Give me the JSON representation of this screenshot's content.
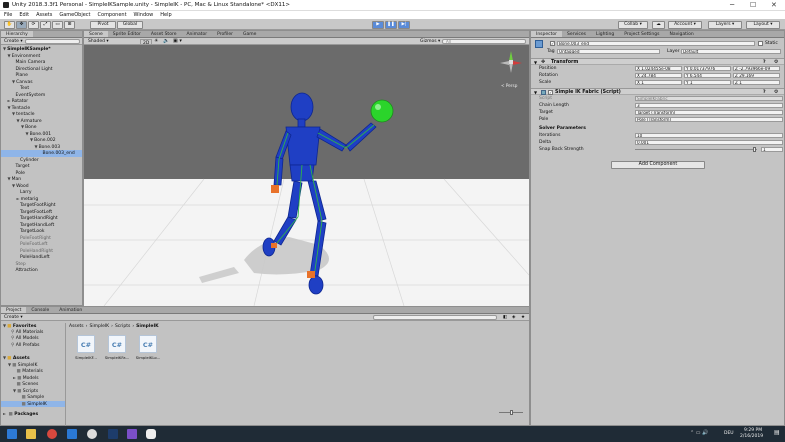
{
  "window": {
    "title": "Unity 2018.3.3f1 Personal - SimpleIKSample.unity - SimpleIK - PC, Mac & Linux Standalone* <DX11>"
  },
  "menu": [
    "File",
    "Edit",
    "Assets",
    "GameObject",
    "Component",
    "Window",
    "Help"
  ],
  "toolbar": {
    "pivot": "Pivot",
    "global": "Global",
    "collab": "Collab",
    "account": "Account",
    "layers": "Layers",
    "layout": "Layout"
  },
  "hierarchy": {
    "tab": "Hierarchy",
    "create": "Create",
    "rows": [
      {
        "t": "SimpleIKSample*",
        "d": 0,
        "a": "▼",
        "b": true
      },
      {
        "t": "Environment",
        "d": 1,
        "a": "▼"
      },
      {
        "t": "Main Camera",
        "d": 2
      },
      {
        "t": "Directional Light",
        "d": 2
      },
      {
        "t": "Plane",
        "d": 2
      },
      {
        "t": "Canvas",
        "d": 2,
        "a": "▼"
      },
      {
        "t": "Text",
        "d": 3
      },
      {
        "t": "EventSystem",
        "d": 2
      },
      {
        "t": "Rotator",
        "d": 1,
        "a": "►"
      },
      {
        "t": "Tentacle",
        "d": 1,
        "a": "▼"
      },
      {
        "t": "tentacle",
        "d": 2,
        "a": "▼"
      },
      {
        "t": "Armature",
        "d": 3,
        "a": "▼"
      },
      {
        "t": "Bone",
        "d": 4,
        "a": "▼"
      },
      {
        "t": "Bone.001",
        "d": 5,
        "a": "▼"
      },
      {
        "t": "Bone.002",
        "d": 6,
        "a": "▼"
      },
      {
        "t": "Bone.003",
        "d": 7,
        "a": "▼"
      },
      {
        "t": "Bone.003_end",
        "d": 8,
        "sel": true
      },
      {
        "t": "Cylinder",
        "d": 3
      },
      {
        "t": "Target",
        "d": 2
      },
      {
        "t": "Pole",
        "d": 2
      },
      {
        "t": "Man",
        "d": 1,
        "a": "▼"
      },
      {
        "t": "Wood",
        "d": 2,
        "a": "▼"
      },
      {
        "t": "Larry",
        "d": 3
      },
      {
        "t": "metarig",
        "d": 3,
        "a": "►"
      },
      {
        "t": "TargetFootRight",
        "d": 3
      },
      {
        "t": "TargetFootLeft",
        "d": 3
      },
      {
        "t": "TargetHandRight",
        "d": 3
      },
      {
        "t": "TargetHandLeft",
        "d": 3
      },
      {
        "t": "TargetLook",
        "d": 3
      },
      {
        "t": "PoleFootRight",
        "d": 3,
        "g": true
      },
      {
        "t": "PoleFootLeft",
        "d": 3,
        "g": true
      },
      {
        "t": "PoleHandRight",
        "d": 3,
        "g": true
      },
      {
        "t": "PoleHandLeft",
        "d": 3
      },
      {
        "t": "Step",
        "d": 2,
        "g": true
      },
      {
        "t": "Attraction",
        "d": 2
      }
    ]
  },
  "scene": {
    "tabs": [
      "Scene",
      "Sprite Editor",
      "Asset Store",
      "Animator",
      "Profiler",
      "Game"
    ],
    "shaded": "Shaded",
    "mode2d": "2D",
    "gizmos": "Gizmos",
    "search_ph": "All",
    "persp": "< Persp"
  },
  "inspector": {
    "tabs": [
      "Inspector",
      "Services",
      "Lighting",
      "Project Settings",
      "Navigation"
    ],
    "object_name": "Bone.003_end",
    "static": "Static",
    "tag_label": "Tag",
    "tag": "Untagged",
    "layer_label": "Layer",
    "layer": "Default",
    "transform": {
      "title": "Transform",
      "position_label": "Position",
      "rotation_label": "Rotation",
      "scale_label": "Scale",
      "position": [
        "X 1.024455e-08",
        "Y 0.01737976",
        "Z -2.793966e-09"
      ],
      "rotation": [
        "X 24.784",
        "Y 6.544",
        "Z 29.169"
      ],
      "scale": [
        "X 1",
        "Y 1",
        "Z 1"
      ]
    },
    "simpleik": {
      "title": "Simple IK Fabric (Script)",
      "script_label": "Script",
      "script": "SimpleIKFabric",
      "chain_label": "Chain Length",
      "chain": "3",
      "target_label": "Target",
      "target": "Target (Transform)",
      "pole_label": "Pole",
      "pole": "Pole (Transform)",
      "solver_header": "Solver Parameters",
      "iter_label": "Iterations",
      "iter": "10",
      "delta_label": "Delta",
      "delta": "0.001",
      "snap_label": "Snap Back Strength",
      "snap": "1"
    },
    "add_component": "Add Component"
  },
  "project": {
    "tabs": [
      "Project",
      "Console",
      "Animation"
    ],
    "create": "Create",
    "favorites": {
      "title": "Favorites",
      "items": [
        "All Materials",
        "All Models",
        "All Prefabs"
      ]
    },
    "assets": {
      "title": "Assets",
      "items": [
        {
          "t": "SimpleIK",
          "d": 1,
          "a": "▼"
        },
        {
          "t": "Materials",
          "d": 2
        },
        {
          "t": "Models",
          "d": 2,
          "a": "►"
        },
        {
          "t": "Scenes",
          "d": 2
        },
        {
          "t": "Scripts",
          "d": 2,
          "a": "▼"
        },
        {
          "t": "Sample",
          "d": 3
        },
        {
          "t": "SimpleIK",
          "d": 3,
          "sel": true
        }
      ]
    },
    "packages": "Packages",
    "breadcrumb": [
      "Assets",
      "SimpleIK",
      "Scripts",
      "SimpleIK"
    ],
    "files": [
      {
        "icon": "C#",
        "name": "SimpleIKF..."
      },
      {
        "icon": "C#",
        "name": "SimpleIKFa..."
      },
      {
        "icon": "C#",
        "name": "SimpleIKLo..."
      }
    ]
  },
  "taskbar": {
    "lang": "DEU",
    "time": "9:29 PM",
    "date": "2/16/2019"
  }
}
